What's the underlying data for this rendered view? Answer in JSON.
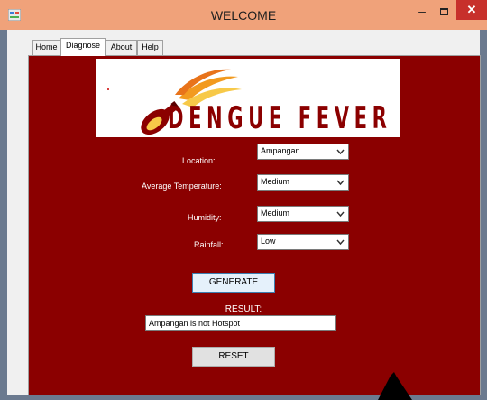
{
  "window": {
    "title": "WELCOME"
  },
  "tabs": [
    {
      "label": "Home"
    },
    {
      "label": "Diagnose"
    },
    {
      "label": "About"
    },
    {
      "label": "Help"
    }
  ],
  "logo": {
    "text": "DENGUE FEVER"
  },
  "form": {
    "location": {
      "label": "Location:",
      "value": "Ampangan"
    },
    "temperature": {
      "label": "Average Temperature:",
      "value": "Medium"
    },
    "humidity": {
      "label": "Humidity:",
      "value": "Medium"
    },
    "rainfall": {
      "label": "Rainfall:",
      "value": "Low"
    }
  },
  "buttons": {
    "generate": "GENERATE",
    "reset": "RESET"
  },
  "result": {
    "label": "RESULT:",
    "value": "Ampangan is not Hotspot"
  },
  "colors": {
    "panel": "#8b0000",
    "titlebar": "#f0a27a",
    "close": "#c7302b",
    "logo_flame_orange": "#f29a1f",
    "logo_flame_yellow": "#f7c948"
  }
}
